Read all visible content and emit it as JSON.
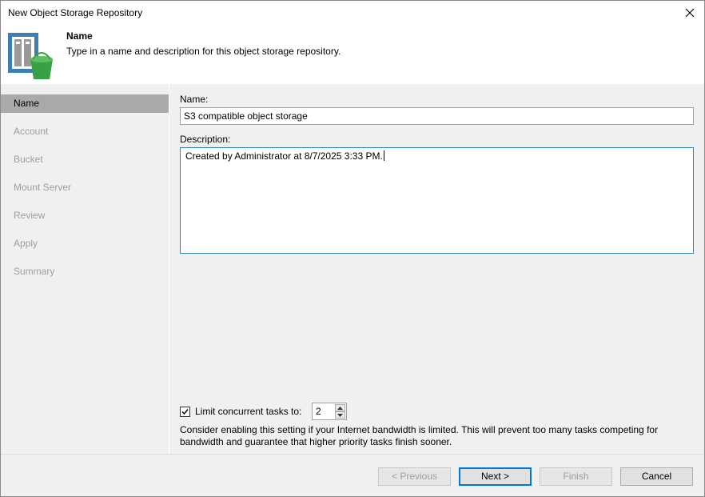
{
  "window": {
    "title": "New Object Storage Repository"
  },
  "header": {
    "title": "Name",
    "subtitle": "Type in a name and description for this object storage repository."
  },
  "steps": [
    {
      "label": "Name",
      "active": true
    },
    {
      "label": "Account",
      "active": false
    },
    {
      "label": "Bucket",
      "active": false
    },
    {
      "label": "Mount Server",
      "active": false
    },
    {
      "label": "Review",
      "active": false
    },
    {
      "label": "Apply",
      "active": false
    },
    {
      "label": "Summary",
      "active": false
    }
  ],
  "form": {
    "name_label": "Name:",
    "name_value": "S3 compatible object storage",
    "description_label": "Description:",
    "description_value": "Created by Administrator at 8/7/2025 3:33 PM.",
    "limit_label": "Limit concurrent tasks to:",
    "limit_checked": true,
    "limit_value": "2",
    "hint": "Consider enabling this setting if your Internet bandwidth is limited. This will prevent too many tasks competing for bandwidth and guarantee that higher priority tasks finish sooner."
  },
  "buttons": {
    "previous": "< Previous",
    "next": "Next >",
    "finish": "Finish",
    "cancel": "Cancel"
  },
  "colors": {
    "accent": "#0078d7",
    "logo_blue": "#3d7fb5",
    "logo_green": "#3aa045",
    "sidebar_active": "#a9a9a9"
  },
  "icons": {
    "close": "close-icon",
    "logo": "object-storage-repository-icon",
    "check": "checkmark-icon"
  }
}
